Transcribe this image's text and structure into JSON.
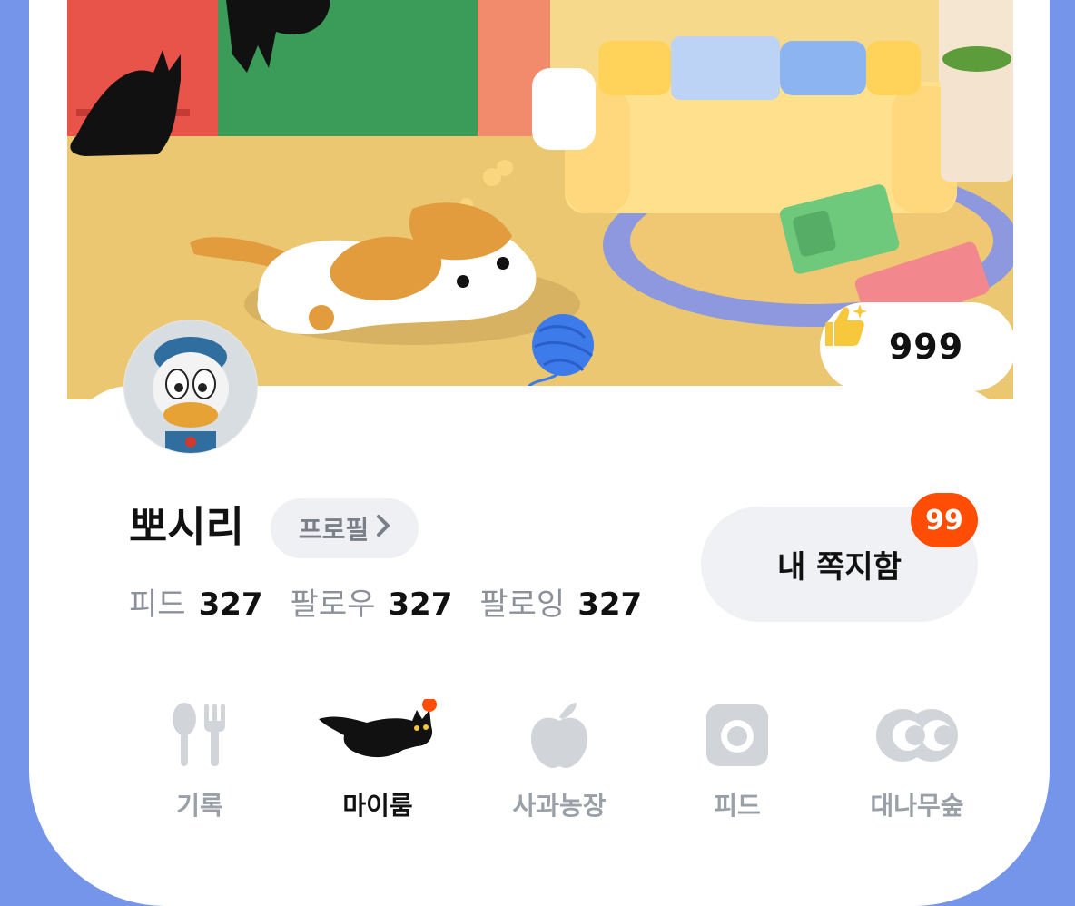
{
  "like": {
    "count": "999",
    "icon": "thumbs-up-icon"
  },
  "profile": {
    "name": "뽀시리",
    "profile_button": "프로필"
  },
  "stats": [
    {
      "label": "피드",
      "value": "327"
    },
    {
      "label": "팔로우",
      "value": "327"
    },
    {
      "label": "팔로잉",
      "value": "327"
    }
  ],
  "messages": {
    "label": "내 쪽지함",
    "badge": "99"
  },
  "nav": [
    {
      "label": "기록",
      "icon": "utensils-icon",
      "active": false
    },
    {
      "label": "마이룸",
      "icon": "black-cat-icon",
      "active": true
    },
    {
      "label": "사과농장",
      "icon": "apple-icon",
      "active": false
    },
    {
      "label": "피드",
      "icon": "camera-icon",
      "active": false
    },
    {
      "label": "대나무숲",
      "icon": "eyes-icon",
      "active": false
    }
  ],
  "colors": {
    "background": "#7595eb",
    "badge": "#ff4d06",
    "inactive": "#9aa0a8",
    "floor": "#ebc771"
  }
}
